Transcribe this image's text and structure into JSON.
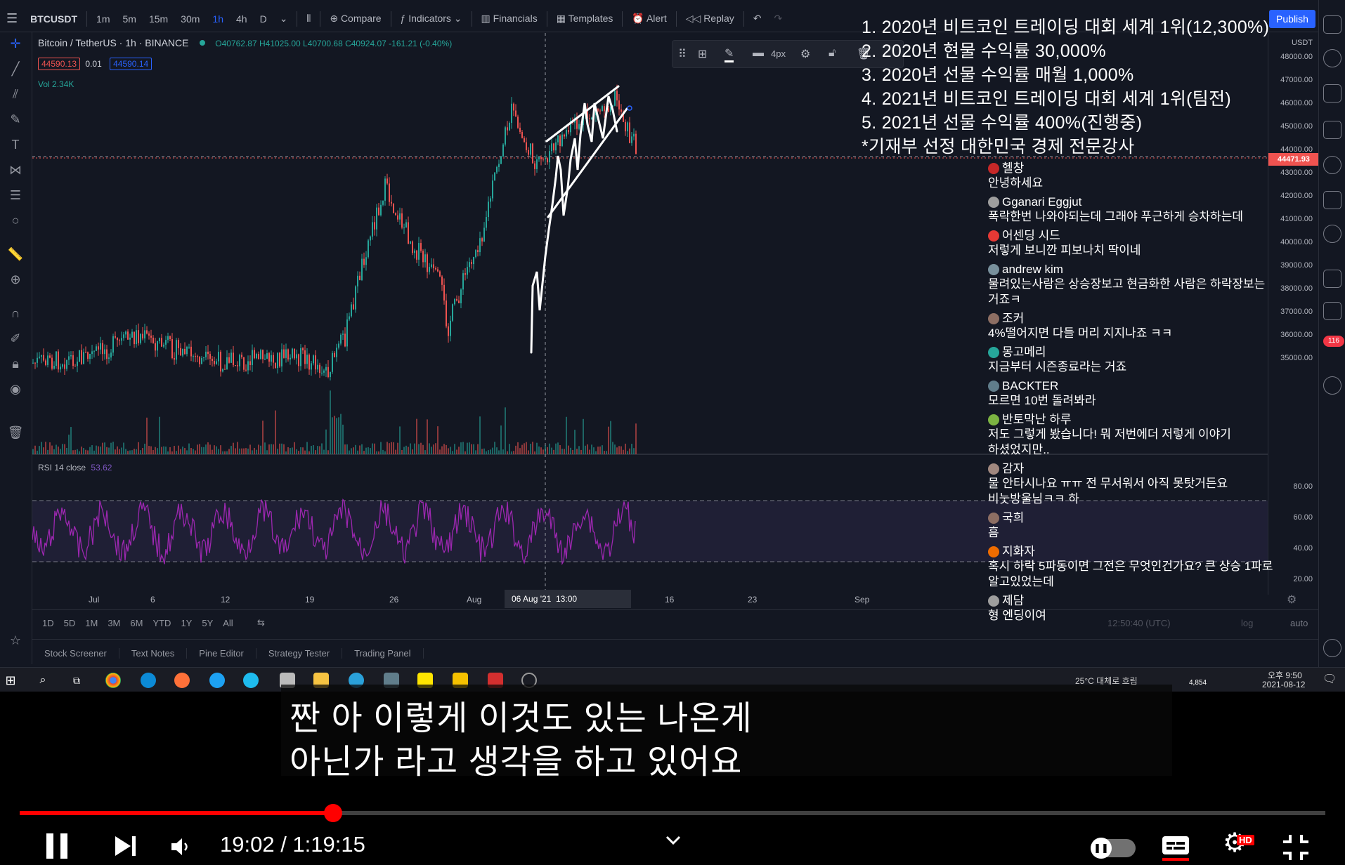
{
  "window": {
    "symbol": "BTCUSDT",
    "intervals": [
      "1m",
      "5m",
      "15m",
      "30m",
      "1h",
      "4h",
      "D"
    ],
    "active_interval": "1h",
    "toolbar": {
      "compare": "Compare",
      "indicators": "Indicators",
      "financials": "Financials",
      "templates": "Templates",
      "alert": "Alert",
      "replay": "Replay",
      "publish": "Publish"
    }
  },
  "legend": {
    "pair": "Bitcoin / TetherUS · 1h · BINANCE",
    "ohlc": "O40762.87 H41025.00 L40700.68 C40924.07 -161.21 (-0.40%)",
    "sell_price": "44590.13",
    "spread": "0.01",
    "buy_price": "44590.14",
    "volume": "Vol 2.34K",
    "rsi_label": "RSI 14 close",
    "rsi_value": "53.62"
  },
  "drawing_toolbar": {
    "stroke_width": "4px"
  },
  "price_axis": {
    "currency": "USDT",
    "labels": [
      "48000.00",
      "47000.00",
      "46000.00",
      "45000.00",
      "44000.00",
      "43000.00",
      "42000.00",
      "41000.00",
      "40000.00",
      "39000.00",
      "38000.00",
      "37000.00",
      "36000.00",
      "35000.00"
    ],
    "current_price": "44471.93",
    "rsi_labels": [
      "80.00",
      "60.00",
      "40.00",
      "20.00"
    ],
    "time_zone": "12:50:40 (UTC)",
    "scale_log": "log",
    "scale_auto": "auto"
  },
  "time_axis": {
    "labels": [
      "Jul",
      "6",
      "12",
      "19",
      "26",
      "Aug",
      "16",
      "23",
      "Sep"
    ],
    "cursor_label": "06 Aug '21  13:00"
  },
  "range_bar": {
    "ranges": [
      "1D",
      "5D",
      "1M",
      "3M",
      "6M",
      "YTD",
      "1Y",
      "5Y",
      "All"
    ]
  },
  "bottom_tabs": [
    "Stock Screener",
    "Text Notes",
    "Pine Editor",
    "Strategy Tester",
    "Trading Panel"
  ],
  "overlay_credentials": [
    "1. 2020년 비트코인 트레이딩 대회 세계 1위(12,300%)",
    "2. 2020년 현물 수익률 30,000%",
    "3. 2020년 선물 수익률 매월 1,000%",
    "4. 2021년 비트코인 트레이딩 대회 세계 1위(팀전)",
    "5. 2021년 선물 수익률 400%(진행중)",
    "*기재부 선정 대한민국 경제 전문강사"
  ],
  "chat": [
    {
      "name": "헬창",
      "text": "안녕하세요",
      "color": "#c62828"
    },
    {
      "name": "Gganari Eggjut",
      "text": "폭락한번 나와야되는데 그래야 푸근하게 승차하는데",
      "color": "#9e9e9e"
    },
    {
      "name": "어센딩 시드",
      "text": "저렇게 보니깐 피보나치 딱이네",
      "color": "#e53935"
    },
    {
      "name": "andrew kim",
      "text": "물려있는사람은 상승장보고 현금화한 사람은 하락장보는 거죠ㅋ",
      "color": "#78909c"
    },
    {
      "name": "조커",
      "text": "4%떨어지면 다들 머리 지지나죠 ㅋㅋ",
      "color": "#8d6e63"
    },
    {
      "name": "몽고메리",
      "text": "지금부터 시즌종료라는 거죠",
      "color": "#26a69a"
    },
    {
      "name": "BACKTER",
      "text": "모르면 10번 돌려봐라",
      "color": "#607d8b"
    },
    {
      "name": "반토막난 하루",
      "text": "저도 그렇게 봤습니다! 뭐 저번에더 저렇게 이야기 하셨었지만..",
      "color": "#7cb342"
    },
    {
      "name": "감자",
      "text": "물 안타시나요 ㅠㅠ 전 무서워서 아직 못탓거든요 비눗방울님ㅋㅋ 하",
      "color": "#a1887f"
    },
    {
      "name": "국희",
      "text": "흠",
      "color": "#8d6e63"
    },
    {
      "name": "지화자",
      "text": "혹시 하락 5파동이면 그전은 무엇인건가요? 큰 상승 1파로 알고있었는데",
      "color": "#ef6c00"
    },
    {
      "name": "제담",
      "text": "형 엔딩이여",
      "color": "#9e9e9e"
    }
  ],
  "taskbar": {
    "weather": "25°C 대체로 흐림",
    "time": "오후 9:50",
    "date": "2021-08-12",
    "badge_count": "4,854"
  },
  "subtitle": {
    "line1": "짠 아 이렇게 이것도 있는 나온게",
    "line2": "아닌가 라고 생각을 하고 있어요"
  },
  "player": {
    "time_display": "19:02 / 1:19:15",
    "progress_fraction": 0.24,
    "hd_badge": "HD",
    "accent_color": "#ff0000"
  },
  "colors": {
    "up": "#26a69a",
    "down": "#ef5350",
    "rsi": "#7e57c2",
    "background": "#131722"
  }
}
